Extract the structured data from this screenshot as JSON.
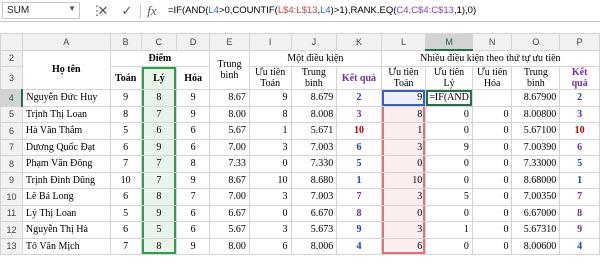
{
  "namebox": "SUM",
  "formula_parts": [
    {
      "t": "=IF(AND(",
      "c": ""
    },
    {
      "t": "L4",
      "c": "f-blue"
    },
    {
      "t": ">0,COUNTIF(",
      "c": ""
    },
    {
      "t": "L$4:L$13",
      "c": "f-red"
    },
    {
      "t": ",",
      "c": ""
    },
    {
      "t": "L4",
      "c": "f-blue"
    },
    {
      "t": ")>1),RANK.EQ(",
      "c": ""
    },
    {
      "t": "C4,C$4:C$13",
      "c": "f-pur"
    },
    {
      "t": ",1),0)",
      "c": ""
    }
  ],
  "columns": [
    "A",
    "B",
    "C",
    "D",
    "E",
    "I",
    "J",
    "K",
    "L",
    "M",
    "N",
    "O",
    "P"
  ],
  "rows": [
    {
      "n": "4",
      "name": "Nguyễn Đức Huy",
      "b": "9",
      "c": "8",
      "d": "9",
      "e": "8.67",
      "i": "9",
      "j": "8.679",
      "k": "2",
      "l": "9",
      "m": "=IF(AND",
      "n2": "",
      "o": "8.67900",
      "p": "2"
    },
    {
      "n": "5",
      "name": "Trịnh Thị Loan",
      "b": "8",
      "c": "7",
      "d": "9",
      "e": "8.00",
      "i": "8",
      "j": "8.008",
      "k": "3",
      "l": "8",
      "m": "0",
      "n2": "0",
      "o": "8.00800",
      "p": "3"
    },
    {
      "n": "6",
      "name": "Hà Văn Thắm",
      "b": "5",
      "c": "6",
      "d": "6",
      "e": "5.67",
      "i": "1",
      "j": "5.671",
      "k": "10",
      "l": "1",
      "m": "0",
      "n2": "0",
      "o": "5.67100",
      "p": "10"
    },
    {
      "n": "7",
      "name": "Dương Quốc Đạt",
      "b": "6",
      "c": "9",
      "d": "6",
      "e": "7.00",
      "i": "3",
      "j": "7.003",
      "k": "6",
      "l": "3",
      "m": "9",
      "n2": "0",
      "o": "7.00390",
      "p": "6"
    },
    {
      "n": "8",
      "name": "Phạm Văn Đông",
      "b": "7",
      "c": "7",
      "d": "8",
      "e": "7.33",
      "i": "0",
      "j": "7.330",
      "k": "5",
      "l": "0",
      "m": "0",
      "n2": "0",
      "o": "7.33000",
      "p": "5"
    },
    {
      "n": "9",
      "name": "Trịnh Đình Dũng",
      "b": "10",
      "c": "7",
      "d": "9",
      "e": "8.67",
      "i": "10",
      "j": "8.680",
      "k": "1",
      "l": "10",
      "m": "0",
      "n2": "0",
      "o": "8.68000",
      "p": "1"
    },
    {
      "n": "10",
      "name": "Lê Bá Long",
      "b": "6",
      "c": "8",
      "d": "7",
      "e": "7.00",
      "i": "3",
      "j": "7.003",
      "k": "7",
      "l": "3",
      "m": "5",
      "n2": "0",
      "o": "7.00350",
      "p": "7"
    },
    {
      "n": "11",
      "name": "Lý Thị Loan",
      "b": "5",
      "c": "9",
      "d": "6",
      "e": "6.67",
      "i": "0",
      "j": "6.670",
      "k": "8",
      "l": "0",
      "m": "0",
      "n2": "0",
      "o": "6.67000",
      "p": "8"
    },
    {
      "n": "12",
      "name": "Nguyễn Thị Hà",
      "b": "6",
      "c": "5",
      "d": "6",
      "e": "5.67",
      "i": "3",
      "j": "5.673",
      "k": "9",
      "l": "3",
      "m": "1",
      "n2": "0",
      "o": "5.67310",
      "p": "9"
    },
    {
      "n": "13",
      "name": "Tô Văn Mịch",
      "b": "7",
      "c": "8",
      "d": "9",
      "e": "8.00",
      "i": "6",
      "j": "8.006",
      "k": "4",
      "l": "6",
      "m": "0",
      "n2": "0",
      "o": "8.00600",
      "p": "4"
    }
  ],
  "header": {
    "row2": "2",
    "row3": "3",
    "ho_ten": "Họ tên",
    "diem": "Điểm",
    "trung_binh": "Trung bình",
    "mot_dieu_kien": "Một điều kiện",
    "nhieu_dieu_kien": "Nhiều điều kiện theo thứ tự ưu tiên",
    "toan": "Toán",
    "ly": "Lý",
    "hoa": "Hóa",
    "uu_tien_toan": "Ưu tiên Toán",
    "trung_binh2": "Trung bình",
    "ket_qua": "Kết quả",
    "uu_tien_toan2": "Ưu tiên Toán",
    "uu_tien_ly": "Ưu tiên Lý",
    "uu_tien_hoa": "Ưu tiên Hóa",
    "trung_binh3": "Trung bình",
    "ket_qua2": "Kết quả"
  },
  "colors": {
    "accent": "#217346",
    "blue": "#1c3fb4",
    "purple": "#7030a0",
    "red": "#c00000"
  }
}
